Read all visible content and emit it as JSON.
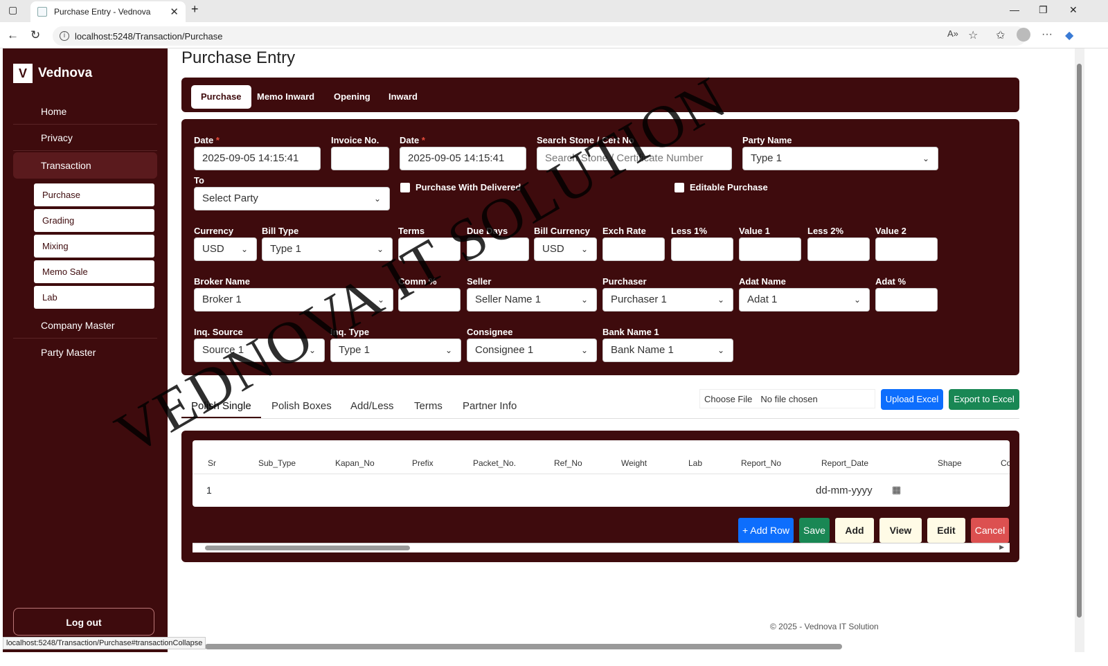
{
  "browser": {
    "tab_title": "Purchase Entry - Vednova",
    "url": "localhost:5248/Transaction/Purchase",
    "status_url": "localhost:5248/Transaction/Purchase#transactionCollapse"
  },
  "sidebar": {
    "brand": "Vednova",
    "logo_letter": "V",
    "items": [
      {
        "label": "Home"
      },
      {
        "label": "Privacy"
      },
      {
        "label": "Transaction"
      },
      {
        "label": "Company Master"
      },
      {
        "label": "Party Master"
      }
    ],
    "sub_items": [
      {
        "label": "Purchase"
      },
      {
        "label": "Grading"
      },
      {
        "label": "Mixing"
      },
      {
        "label": "Memo Sale"
      },
      {
        "label": "Lab"
      }
    ],
    "logout": "Log out"
  },
  "page": {
    "title": "Purchase Entry",
    "tabs": [
      "Purchase",
      "Memo Inward",
      "Opening",
      "Inward"
    ]
  },
  "form": {
    "date1": {
      "label": "Date",
      "value": "2025-09-05 14:15:41"
    },
    "invoice": {
      "label": "Invoice No.",
      "value": ""
    },
    "date2": {
      "label": "Date",
      "value": "2025-09-05 14:15:41"
    },
    "search": {
      "label": "Search Stone / Cert No",
      "placeholder": "Search Stone / Certificate Number"
    },
    "party_name": {
      "label": "Party Name",
      "value": "Type 1"
    },
    "to": {
      "label": "To",
      "value": "Select Party"
    },
    "purchase_delivered": "Purchase With Delivered",
    "editable_purchase": "Editable Purchase",
    "currency": {
      "label": "Currency",
      "value": "USD"
    },
    "bill_type": {
      "label": "Bill Type",
      "value": "Type 1"
    },
    "terms": {
      "label": "Terms",
      "value": ""
    },
    "due_days": {
      "label": "Due Days",
      "value": ""
    },
    "bill_currency": {
      "label": "Bill Currency",
      "value": "USD"
    },
    "exch_rate": {
      "label": "Exch Rate",
      "value": ""
    },
    "less1": {
      "label": "Less 1%",
      "value": ""
    },
    "value1": {
      "label": "Value 1",
      "value": ""
    },
    "less2": {
      "label": "Less 2%",
      "value": ""
    },
    "value2": {
      "label": "Value 2",
      "value": ""
    },
    "broker": {
      "label": "Broker Name",
      "value": "Broker 1"
    },
    "comm": {
      "label": "Comm %",
      "value": ""
    },
    "seller": {
      "label": "Seller",
      "value": "Seller Name 1"
    },
    "purchaser": {
      "label": "Purchaser",
      "value": "Purchaser 1"
    },
    "adat_name": {
      "label": "Adat Name",
      "value": "Adat 1"
    },
    "adat_pct": {
      "label": "Adat %",
      "value": ""
    },
    "inq_source": {
      "label": "Inq. Source",
      "value": "Source 1"
    },
    "inq_type": {
      "label": "Inq. Type",
      "value": "Type 1"
    },
    "consignee": {
      "label": "Consignee",
      "value": "Consignee 1"
    },
    "bank": {
      "label": "Bank Name 1",
      "value": "Bank Name 1"
    }
  },
  "detail_tabs": [
    "Polish Single",
    "Polish Boxes",
    "Add/Less",
    "Terms",
    "Partner Info"
  ],
  "file": {
    "choose": "Choose File",
    "status": "No file chosen"
  },
  "excel": {
    "upload": "Upload Excel",
    "export": "Export to Excel"
  },
  "table": {
    "headers": [
      "Sr",
      "Sub_Type",
      "Kapan_No",
      "Prefix",
      "Packet_No.",
      "Ref_No",
      "Weight",
      "Lab",
      "Report_No",
      "Report_Date",
      "Shape",
      "Co"
    ],
    "row": {
      "sr": "1",
      "report_date": "dd-mm-yyyy"
    }
  },
  "actions": {
    "add_row": "+ Add Row",
    "save": "Save",
    "add": "Add",
    "view": "View",
    "edit": "Edit",
    "cancel": "Cancel"
  },
  "footer": "© 2025 - Vednova IT Solution",
  "watermark": "VEDNOVA IT SOLUTION",
  "colors": {
    "primary": "#3e0b0d",
    "blue": "#0d6efd",
    "green": "#198754",
    "red": "#dc3545"
  }
}
